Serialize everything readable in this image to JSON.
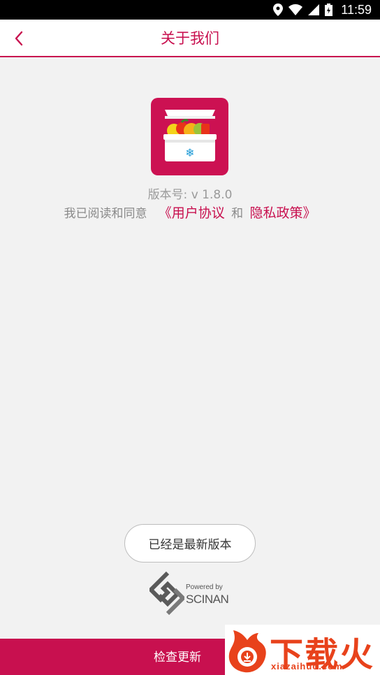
{
  "status_bar": {
    "time": "11:59"
  },
  "header": {
    "title": "关于我们"
  },
  "about": {
    "version": "版本号: v 1.8.0",
    "agree_prefix": "我已阅读和同意",
    "user_agreement": "《用户协议",
    "and": "和",
    "privacy_policy": "隐私政策》"
  },
  "update_status_label": "已经是最新版本",
  "powered": {
    "by": "Powered by",
    "brand": "SCINAN"
  },
  "bottom": {
    "check_update_label": "检查更新"
  },
  "watermark": {
    "text": "下载火",
    "url": "xiazaihuo.com"
  },
  "colors": {
    "accent": "#c8104f",
    "watermark": "#e8421b"
  }
}
